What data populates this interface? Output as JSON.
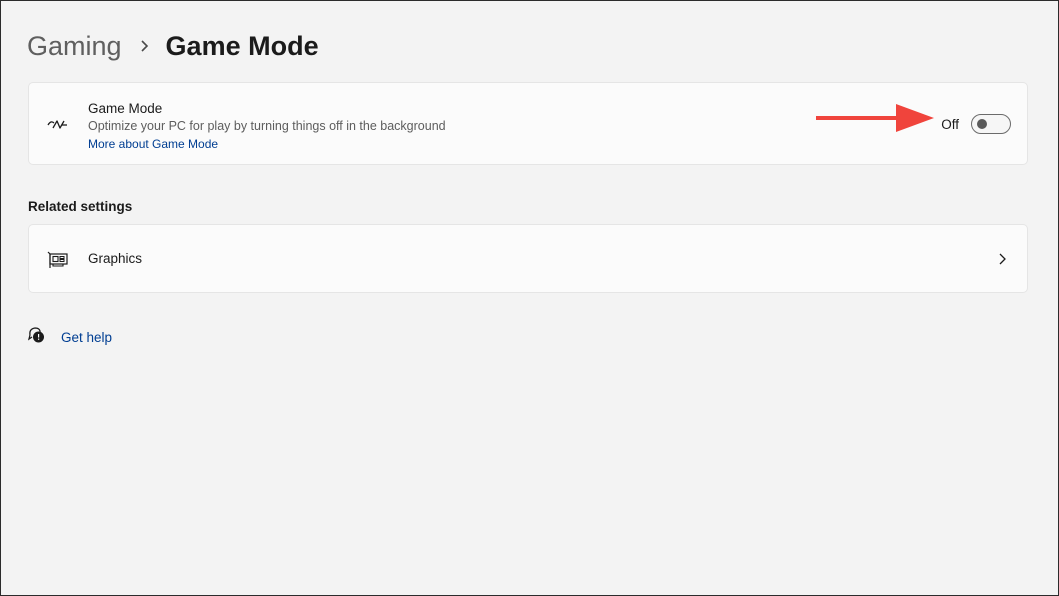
{
  "breadcrumb": {
    "parent": "Gaming",
    "current": "Game Mode"
  },
  "game_mode_card": {
    "icon": "game-mode-icon",
    "title": "Game Mode",
    "description": "Optimize your PC for play by turning things off in the background",
    "link": "More about Game Mode",
    "toggle_state_label": "Off",
    "toggle_on": false
  },
  "annotation": {
    "type": "arrow",
    "color": "#f0443c",
    "points_to": "toggle"
  },
  "related_settings": {
    "heading": "Related settings",
    "items": [
      {
        "icon": "graphics-card-icon",
        "label": "Graphics"
      }
    ]
  },
  "help": {
    "icon": "help-icon",
    "label": "Get help"
  },
  "colors": {
    "background": "#f3f3f3",
    "card": "#fbfbfb",
    "link": "#003e92"
  }
}
